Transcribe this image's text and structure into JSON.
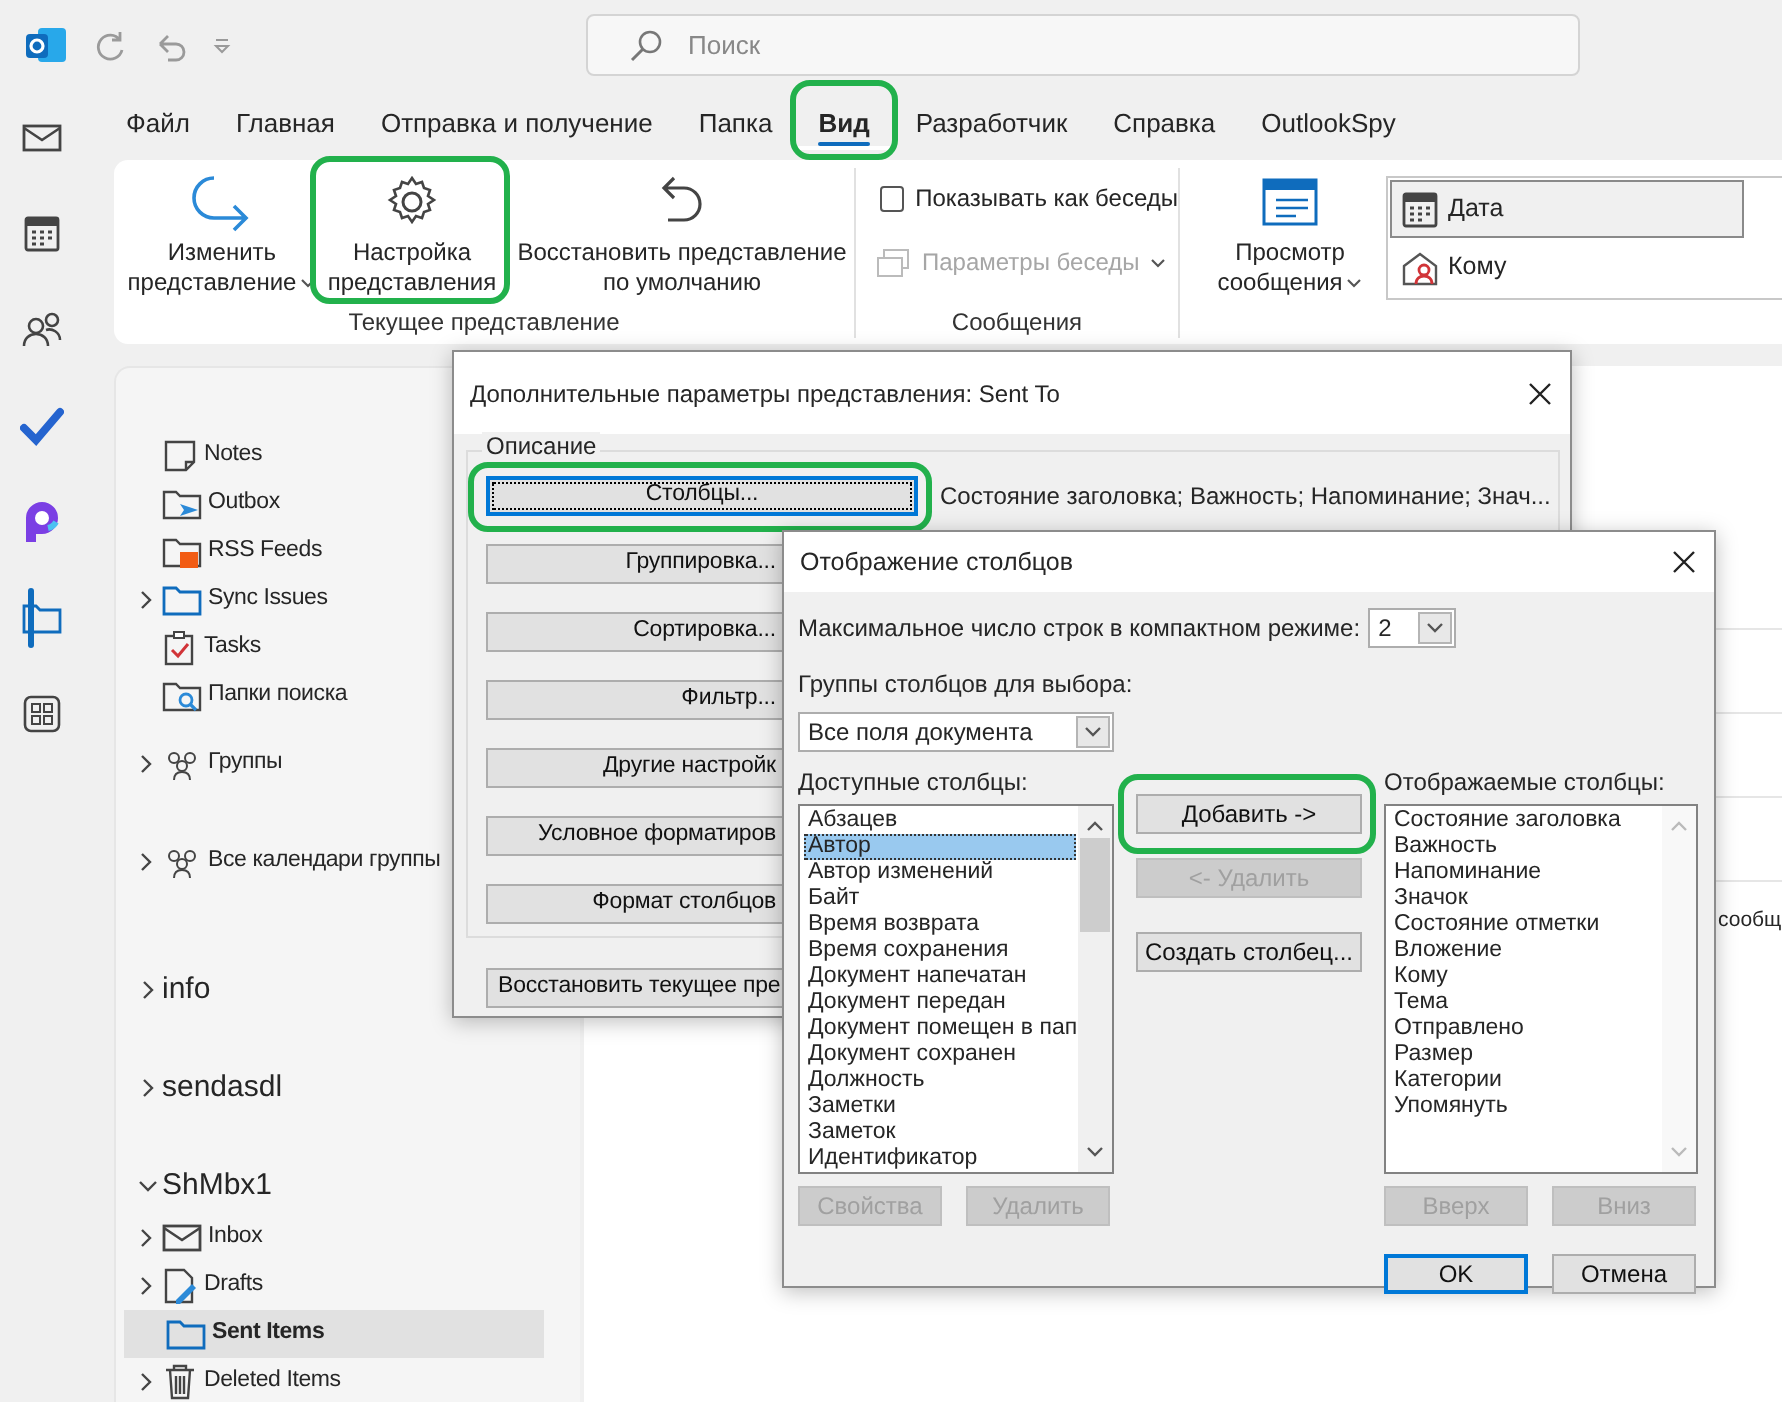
{
  "title_bar": {
    "search_placeholder": "Поиск"
  },
  "nav_rail": [
    {
      "kind": "mail",
      "selected": false
    },
    {
      "kind": "calendar",
      "selected": false
    },
    {
      "kind": "people",
      "selected": false
    },
    {
      "kind": "todo",
      "selected": false
    },
    {
      "kind": "loop",
      "selected": false
    },
    {
      "kind": "folder",
      "selected": true
    },
    {
      "kind": "apps",
      "selected": false
    }
  ],
  "tabs": [
    {
      "label": "Файл",
      "selected": false,
      "highlighted": false
    },
    {
      "label": "Главная",
      "selected": false,
      "highlighted": false
    },
    {
      "label": "Отправка и получение",
      "selected": false,
      "highlighted": false
    },
    {
      "label": "Папка",
      "selected": false,
      "highlighted": false
    },
    {
      "label": "Вид",
      "selected": true,
      "highlighted": true
    },
    {
      "label": "Разработчик",
      "selected": false,
      "highlighted": false
    },
    {
      "label": "Справка",
      "selected": false,
      "highlighted": false
    },
    {
      "label": "OutlookSpy",
      "selected": false,
      "highlighted": false
    }
  ],
  "ribbon": {
    "view_group": {
      "label": "Текущее представление",
      "buttons": [
        {
          "kind": "change",
          "lines": [
            "Изменить",
            "представление"
          ],
          "dropdown": true,
          "highlighted": false
        },
        {
          "kind": "gear",
          "lines": [
            "Настройка",
            "представления"
          ],
          "dropdown": false,
          "highlighted": true
        },
        {
          "kind": "reset",
          "lines": [
            "Восстановить представление",
            "по умолчанию"
          ],
          "dropdown": false,
          "highlighted": false
        }
      ]
    },
    "messages_group": {
      "label": "Сообщения",
      "checkbox": {
        "label": "Показывать как беседы",
        "checked": false
      },
      "settings": {
        "label": "Параметры беседы",
        "disabled": true,
        "dropdown": true
      }
    },
    "layout_group": {
      "preview": {
        "lines": [
          "Просмотр",
          "сообщения"
        ],
        "dropdown": true
      },
      "arrange": [
        {
          "label": "Дата",
          "kind": "calendar",
          "selected": true
        },
        {
          "label": "Кому",
          "kind": "person",
          "selected": false
        }
      ]
    }
  },
  "folder_pane": {
    "folders": [
      {
        "label": "Notes",
        "kind": "note",
        "expandable": false,
        "selected": false
      },
      {
        "label": "Outbox",
        "kind": "outbox",
        "expandable": false,
        "selected": false
      },
      {
        "label": "RSS Feeds",
        "kind": "rss",
        "expandable": false,
        "selected": false
      },
      {
        "label": "Sync Issues",
        "kind": "folder",
        "expandable": true,
        "selected": false
      },
      {
        "label": "Tasks",
        "kind": "tasks",
        "expandable": false,
        "selected": false
      },
      {
        "label": "Папки поиска",
        "kind": "search-folder",
        "expandable": false,
        "selected": false
      }
    ],
    "groups": [
      {
        "label": "Группы",
        "expandable": true,
        "selected": false
      },
      {
        "label": "Все календари группы",
        "expandable": true,
        "selected": false
      }
    ],
    "accounts": [
      {
        "name": "info",
        "expanded": false
      },
      {
        "name": "sendasdl",
        "expanded": false
      },
      {
        "name": "ShMbx1",
        "expanded": true,
        "children": [
          {
            "label": "Inbox",
            "kind": "mail",
            "expandable": true,
            "selected": false
          },
          {
            "label": "Drafts",
            "kind": "drafts",
            "expandable": true,
            "selected": false
          },
          {
            "label": "Sent Items",
            "kind": "folder",
            "expandable": false,
            "selected": true
          },
          {
            "label": "Deleted Items",
            "kind": "trash",
            "expandable": true,
            "selected": false
          }
        ]
      }
    ]
  },
  "message_list": {
    "snippet": "сообщ"
  },
  "advanced_dialog": {
    "title": "Дополнительные параметры представления: Sent To",
    "group": "Описание",
    "options": [
      {
        "button": "Столбцы...",
        "description": "Состояние заголовка; Важность; Напоминание; Знач...",
        "focused": true,
        "highlighted": true
      },
      {
        "button": "Группировка...",
        "focused": false,
        "highlighted": false
      },
      {
        "button": "Сортировка...",
        "focused": false,
        "highlighted": false
      },
      {
        "button": "Фильтр...",
        "focused": false,
        "highlighted": false
      },
      {
        "button": "Другие настройк",
        "focused": false,
        "highlighted": false
      },
      {
        "button": "Условное форматиров",
        "focused": false,
        "highlighted": false
      },
      {
        "button": "Формат столбцов",
        "focused": false,
        "highlighted": false
      }
    ],
    "restore_button": "Восстановить текущее пре"
  },
  "columns_dialog": {
    "title": "Отображение столбцов",
    "max_rows": {
      "label": "Максимальное число строк в компактном режиме:",
      "value": "2"
    },
    "group_select": {
      "label": "Группы столбцов для выбора:",
      "value": "Все поля документа"
    },
    "available": {
      "label": "Доступные столбцы:",
      "items": [
        {
          "label": "Абзацев",
          "selected": false
        },
        {
          "label": "Автор",
          "selected": true
        },
        {
          "label": "Автор изменений",
          "selected": false
        },
        {
          "label": "Байт",
          "selected": false
        },
        {
          "label": "Время возврата",
          "selected": false
        },
        {
          "label": "Время сохранения",
          "selected": false
        },
        {
          "label": "Документ напечатан",
          "selected": false
        },
        {
          "label": "Документ передан",
          "selected": false
        },
        {
          "label": "Документ помещен в пап",
          "selected": false
        },
        {
          "label": "Документ сохранен",
          "selected": false
        },
        {
          "label": "Должность",
          "selected": false
        },
        {
          "label": "Заметки",
          "selected": false
        },
        {
          "label": "Заметок",
          "selected": false
        },
        {
          "label": "Идентификатор",
          "selected": false
        }
      ]
    },
    "actions": [
      {
        "label": "Добавить ->",
        "disabled": false,
        "highlighted": true
      },
      {
        "label": "<- Удалить",
        "disabled": true,
        "highlighted": false
      },
      {
        "label": "Создать столбец...",
        "disabled": false,
        "highlighted": false
      }
    ],
    "shown": {
      "label": "Отображаемые столбцы:",
      "items": [
        {
          "label": "Состояние заголовка",
          "selected": false
        },
        {
          "label": "Важность",
          "selected": false
        },
        {
          "label": "Напоминание",
          "selected": false
        },
        {
          "label": "Значок",
          "selected": false
        },
        {
          "label": "Состояние отметки",
          "selected": false
        },
        {
          "label": "Вложение",
          "selected": false
        },
        {
          "label": "Кому",
          "selected": false
        },
        {
          "label": "Тема",
          "selected": false
        },
        {
          "label": "Отправлено",
          "selected": false
        },
        {
          "label": "Размер",
          "selected": false
        },
        {
          "label": "Категории",
          "selected": false
        },
        {
          "label": "Упомянуть",
          "selected": false
        }
      ]
    },
    "list_buttons": [
      {
        "label": "Свойства",
        "disabled": true
      },
      {
        "label": "Удалить",
        "disabled": true
      }
    ],
    "order_buttons": [
      {
        "label": "Вверх",
        "disabled": true
      },
      {
        "label": "Вниз",
        "disabled": true
      }
    ],
    "footer": [
      {
        "label": "OK",
        "default": true
      },
      {
        "label": "Отмена",
        "default": false
      }
    ]
  }
}
